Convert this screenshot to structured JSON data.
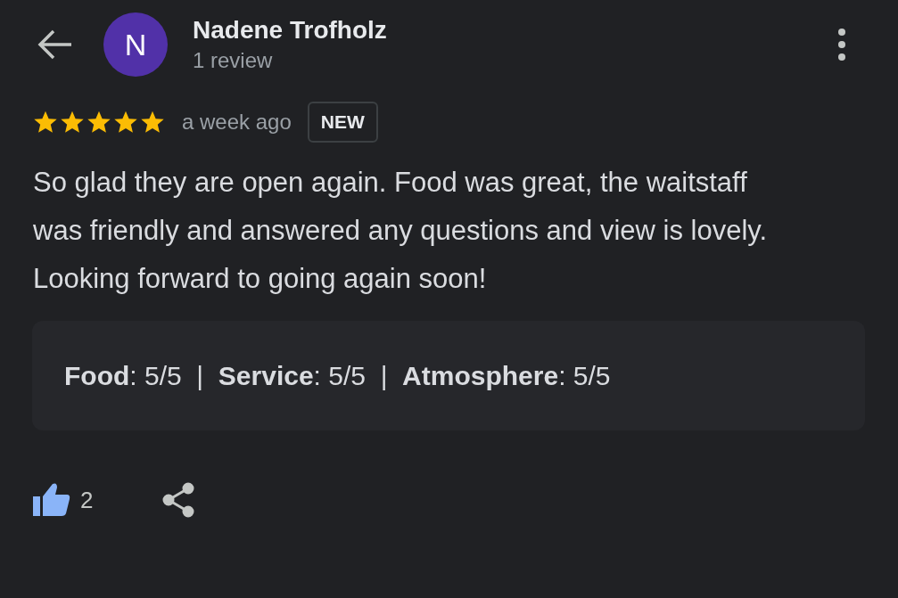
{
  "reviewer": {
    "initial": "N",
    "color": "#5131a8",
    "name": "Nadene Trofholz",
    "review_count": "1 review"
  },
  "review": {
    "stars": 5,
    "time": "a week ago",
    "badge": "NEW",
    "text": "So glad they are open again. Food was great, the waitstaff was friendly and answered any questions and view is lovely. Looking forward to going again soon!",
    "ratings": "**Food**: 5/5  |  **Service**: 5/5  |  **Atmosphere**: 5/5"
  },
  "actions": {
    "liked": true,
    "like_count": "2"
  }
}
